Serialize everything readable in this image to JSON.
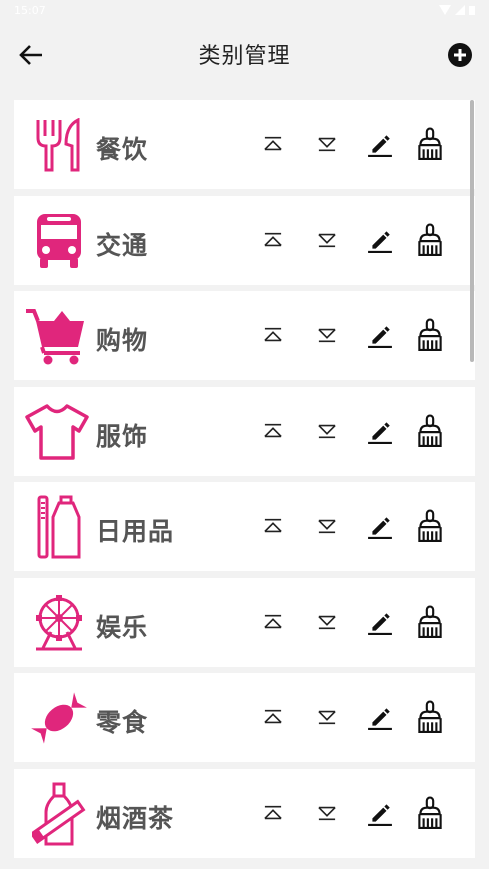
{
  "status_bar": {
    "time": "15:07"
  },
  "header": {
    "title": "类别管理"
  },
  "colors": {
    "accent": "#e0267c",
    "text": "#222222",
    "label": "#555555"
  },
  "categories": [
    {
      "label": "餐饮",
      "icon": "utensils-icon"
    },
    {
      "label": "交通",
      "icon": "bus-icon"
    },
    {
      "label": "购物",
      "icon": "shopping-cart-icon"
    },
    {
      "label": "服饰",
      "icon": "tshirt-icon"
    },
    {
      "label": "日用品",
      "icon": "toothbrush-toothpaste-icon"
    },
    {
      "label": "娱乐",
      "icon": "ferris-wheel-icon"
    },
    {
      "label": "零食",
      "icon": "candy-icon"
    },
    {
      "label": "烟酒茶",
      "icon": "bottle-icon"
    }
  ]
}
